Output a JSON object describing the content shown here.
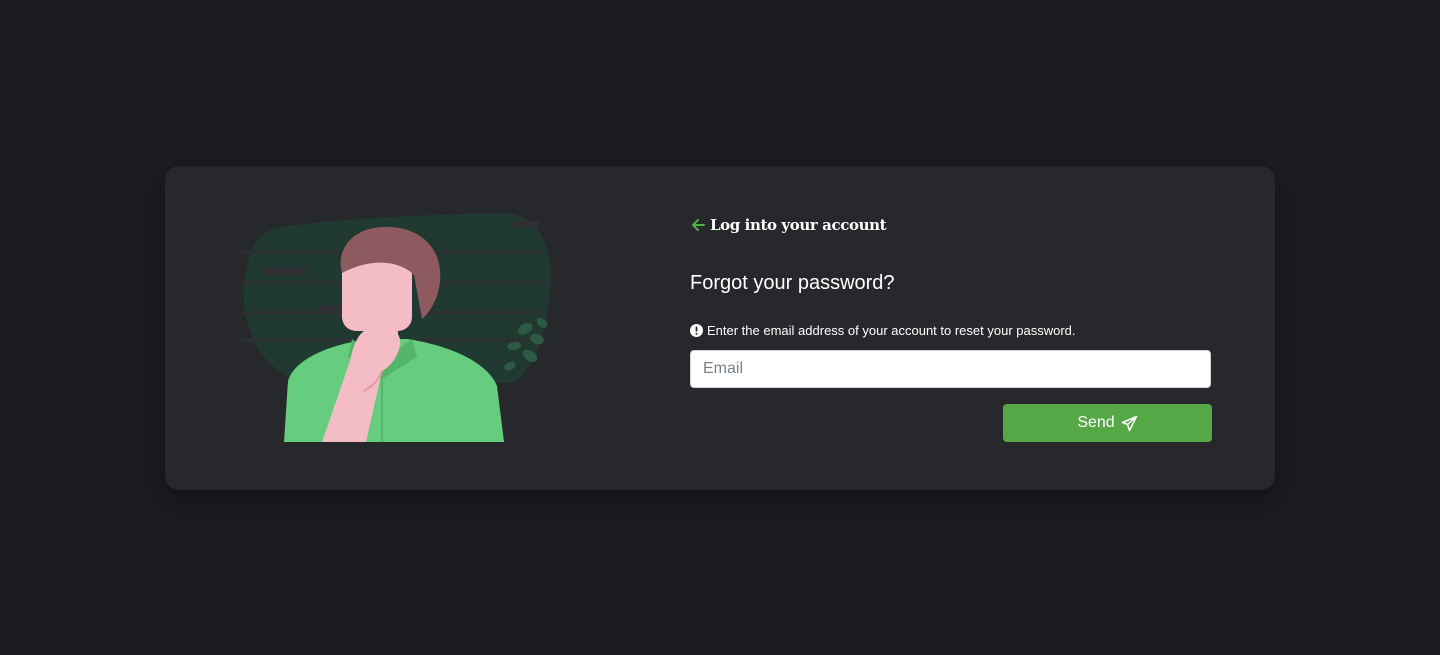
{
  "back_link": {
    "label": "Log into your account",
    "icon": "arrow-left-icon",
    "accent_color": "#4fae46"
  },
  "heading": "Forgot your password?",
  "hint": {
    "icon": "exclamation-circle-icon",
    "text": "Enter the email address of your account to reset your password."
  },
  "email": {
    "placeholder": "Email",
    "value": ""
  },
  "send_button": {
    "label": "Send",
    "icon": "paper-plane-icon",
    "color": "#55a845"
  },
  "illustration": {
    "subject": "thinking-person-illustration"
  }
}
